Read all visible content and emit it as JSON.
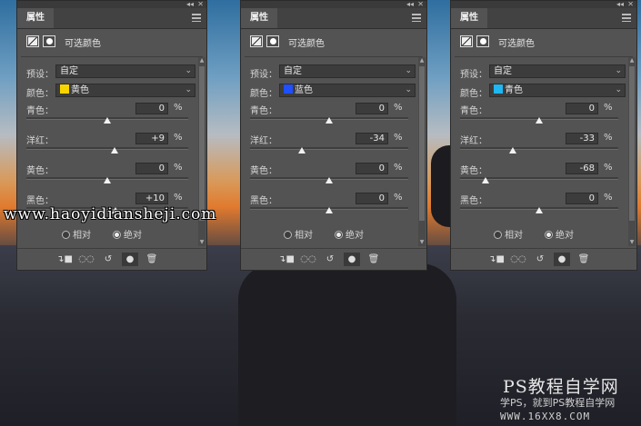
{
  "panels": [
    {
      "tab": "属性",
      "title": "可选颜色",
      "preset_label": "预设：",
      "preset_value": "自定",
      "color_label": "颜色：",
      "color_value": "黄色",
      "color_swatch": "#f7d400",
      "sliders": [
        {
          "label": "青色：",
          "value": "0",
          "unit": "%",
          "level": 0
        },
        {
          "label": "洋红：",
          "value": "+9",
          "unit": "%",
          "level": 9
        },
        {
          "label": "黄色：",
          "value": "0",
          "unit": "%",
          "level": 0
        },
        {
          "label": "黑色：",
          "value": "+10",
          "unit": "%",
          "level": 10
        }
      ],
      "method_relative": "相对",
      "method_absolute": "绝对",
      "method_selected": "absolute"
    },
    {
      "tab": "属性",
      "title": "可选颜色",
      "preset_label": "预设：",
      "preset_value": "自定",
      "color_label": "颜色：",
      "color_value": "蓝色",
      "color_swatch": "#1f4fff",
      "sliders": [
        {
          "label": "青色：",
          "value": "0",
          "unit": "%",
          "level": 0
        },
        {
          "label": "洋红：",
          "value": "-34",
          "unit": "%",
          "level": -34
        },
        {
          "label": "黄色：",
          "value": "0",
          "unit": "%",
          "level": 0
        },
        {
          "label": "黑色：",
          "value": "0",
          "unit": "%",
          "level": 0
        }
      ],
      "method_relative": "相对",
      "method_absolute": "绝对",
      "method_selected": "absolute"
    },
    {
      "tab": "属性",
      "title": "可选颜色",
      "preset_label": "预设：",
      "preset_value": "自定",
      "color_label": "颜色：",
      "color_value": "青色",
      "color_swatch": "#1fb6f2",
      "sliders": [
        {
          "label": "青色：",
          "value": "0",
          "unit": "%",
          "level": 0
        },
        {
          "label": "洋红：",
          "value": "-33",
          "unit": "%",
          "level": -33
        },
        {
          "label": "黄色：",
          "value": "-68",
          "unit": "%",
          "level": -68
        },
        {
          "label": "黑色：",
          "value": "0",
          "unit": "%",
          "level": 0
        }
      ],
      "method_relative": "相对",
      "method_absolute": "绝对",
      "method_selected": "absolute"
    }
  ],
  "toolbar_icons": [
    "clip-to-layer-icon",
    "view-previous-icon",
    "reset-icon",
    "visibility-eye-icon",
    "trash-icon"
  ],
  "watermarks": {
    "url": "www.haoyidiansheji.com",
    "brand_title": "PS教程自学网",
    "brand_sub": "学PS，就到PS教程自学网",
    "brand_url": "WWW.16XX8.COM"
  }
}
